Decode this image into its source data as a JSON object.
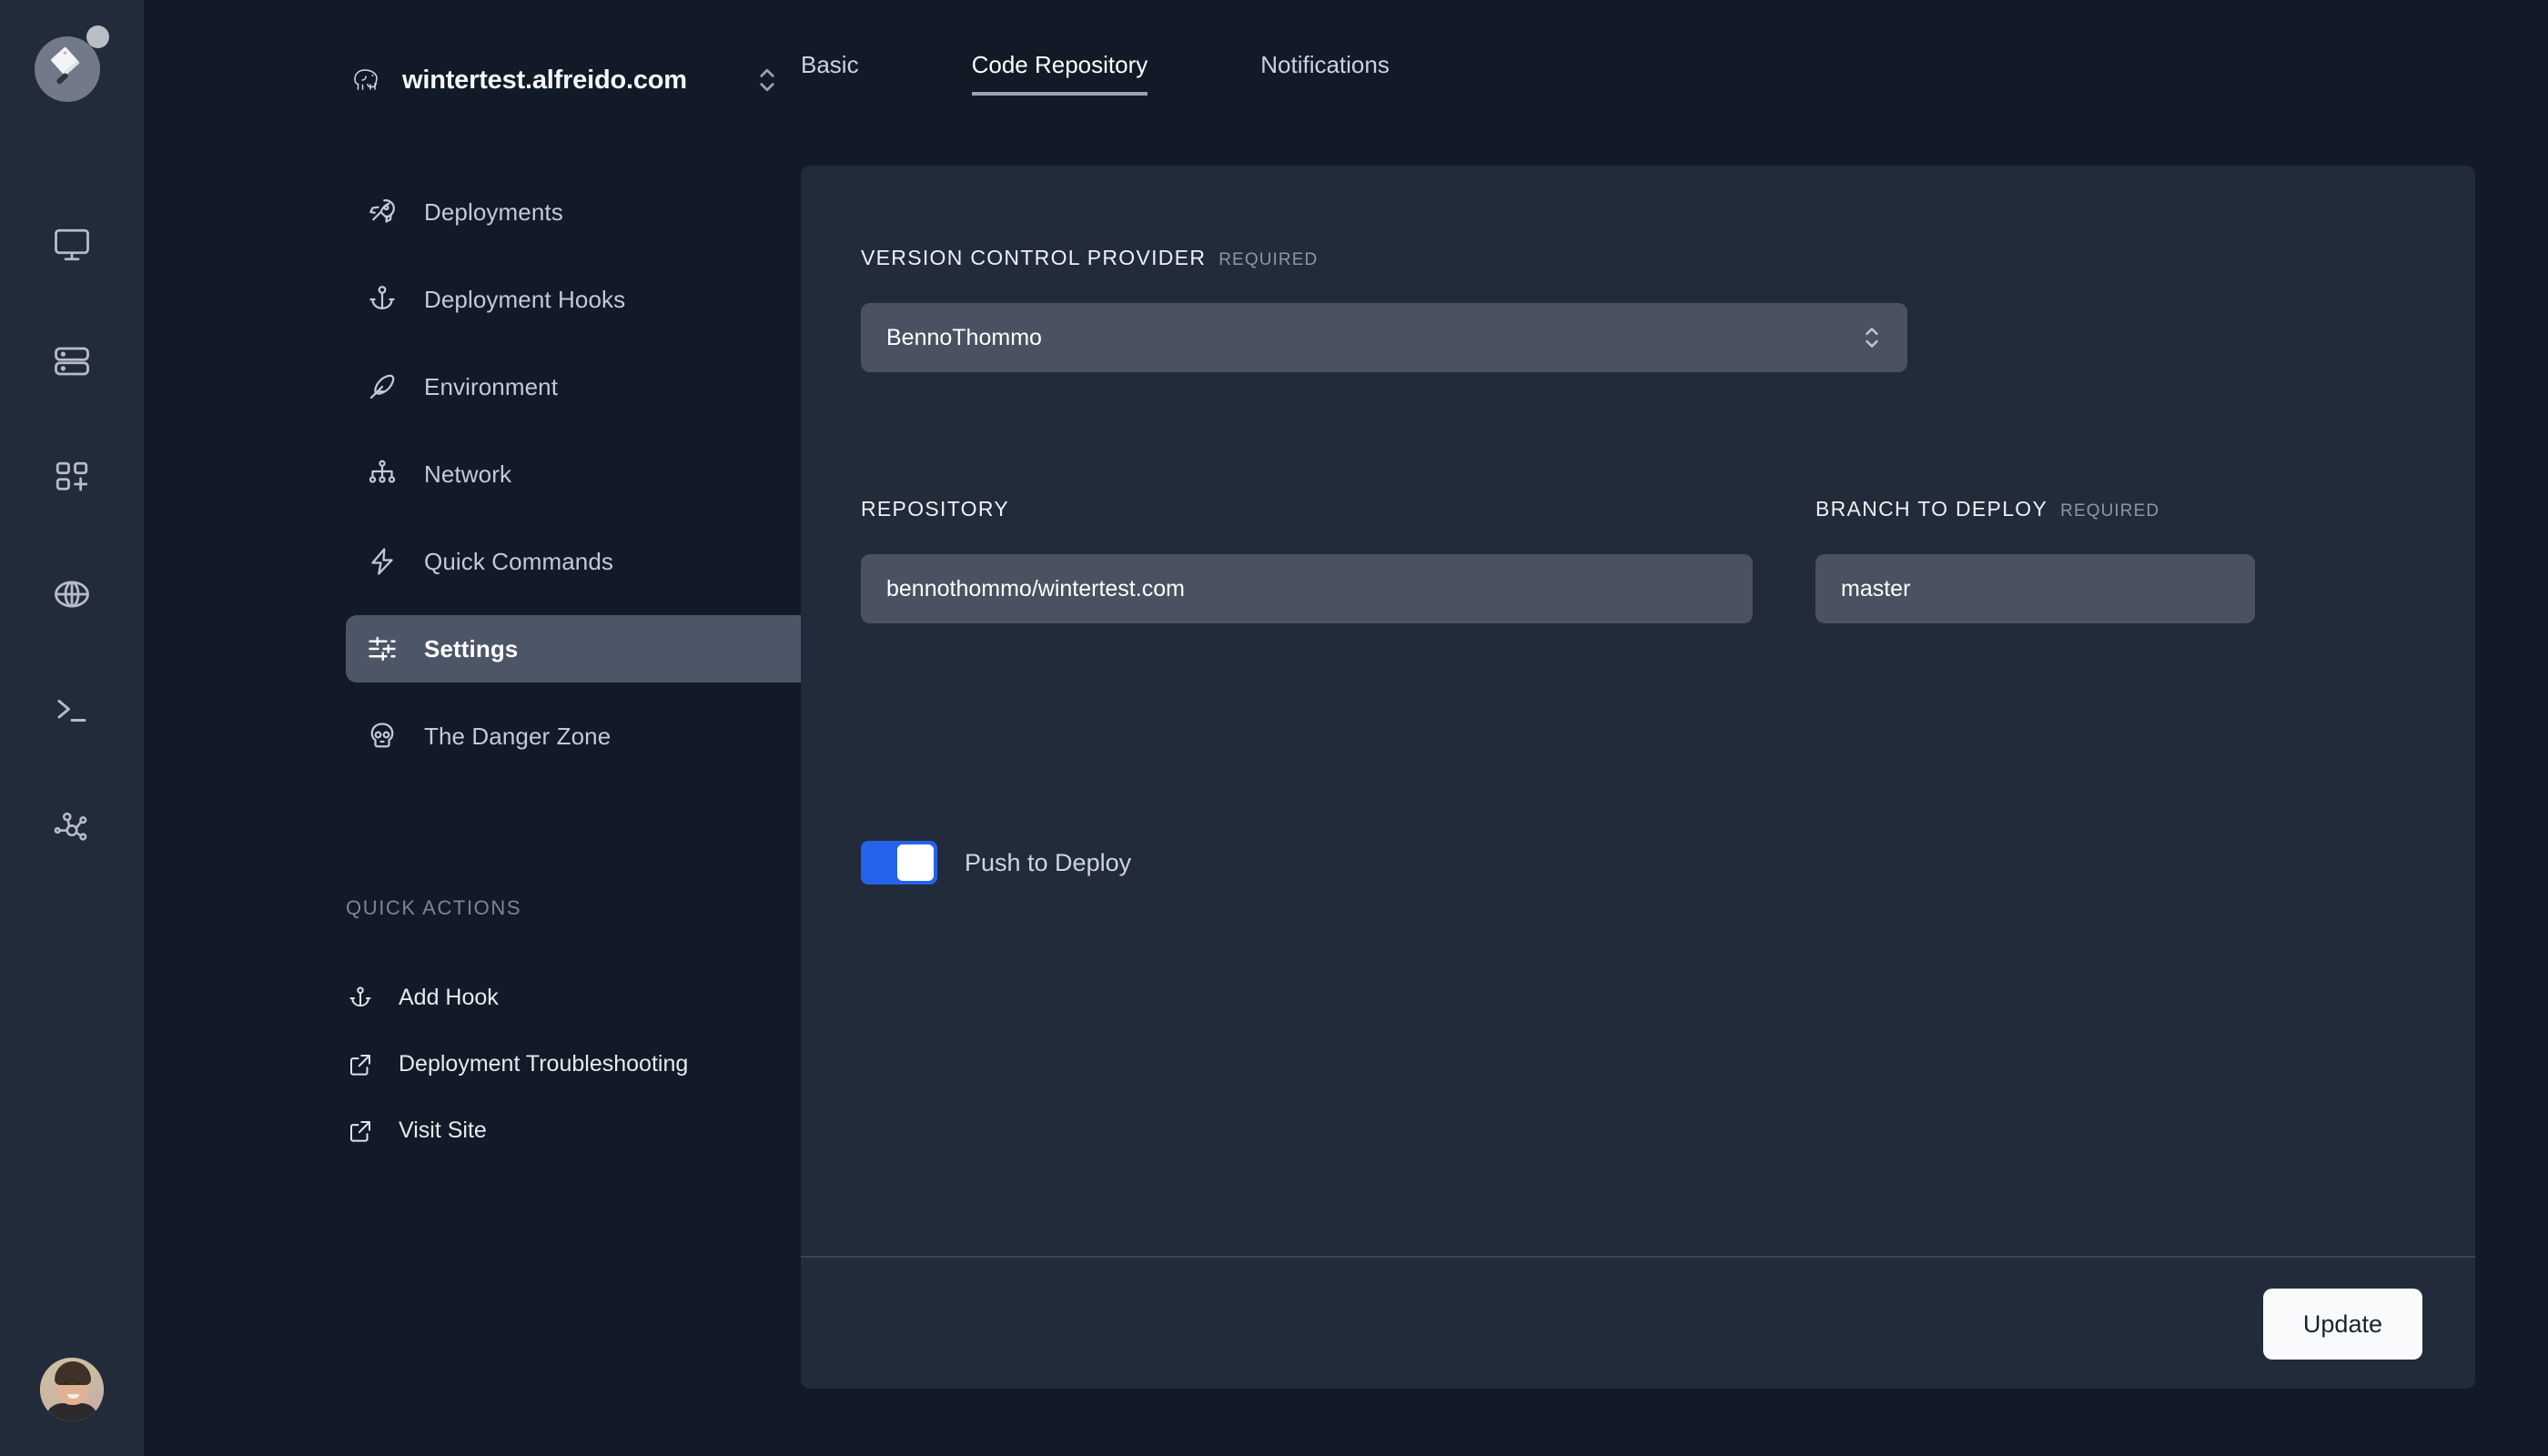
{
  "brand": {
    "logo_icon": "cleaver-icon",
    "logo_badge_icon": "badge-dot-icon"
  },
  "rail": {
    "items": [
      {
        "name": "monitor-icon",
        "label": "Servers"
      },
      {
        "name": "database-icon",
        "label": "Databases"
      },
      {
        "name": "grid-plus-icon",
        "label": "Apps"
      },
      {
        "name": "globe-icon",
        "label": "Domains"
      },
      {
        "name": "terminal-icon",
        "label": "Console"
      },
      {
        "name": "network-share-icon",
        "label": "Network"
      }
    ],
    "avatar": {
      "name": "user-avatar",
      "label": "Account"
    }
  },
  "sidebar": {
    "site": {
      "icon": "elephant-icon",
      "name": "wintertest.alfreido.com",
      "switcher_icon": "chevron-up-down-icon"
    },
    "nav": [
      {
        "label": "Deployments",
        "icon": "rocket-icon",
        "active": false
      },
      {
        "label": "Deployment Hooks",
        "icon": "anchor-icon",
        "active": false
      },
      {
        "label": "Environment",
        "icon": "feather-icon",
        "active": false
      },
      {
        "label": "Network",
        "icon": "network-tree-icon",
        "active": false
      },
      {
        "label": "Quick Commands",
        "icon": "lightning-icon",
        "active": false
      },
      {
        "label": "Settings",
        "icon": "sliders-icon",
        "active": true
      },
      {
        "label": "The Danger Zone",
        "icon": "skull-icon",
        "active": false
      }
    ],
    "quick_actions": {
      "title": "QUICK ACTIONS",
      "items": [
        {
          "label": "Add Hook",
          "icon": "anchor-icon"
        },
        {
          "label": "Deployment Troubleshooting",
          "icon": "external-link-icon"
        },
        {
          "label": "Visit Site",
          "icon": "external-link-icon"
        }
      ]
    }
  },
  "main": {
    "tabs": [
      {
        "label": "Basic",
        "active": false
      },
      {
        "label": "Code Repository",
        "active": true
      },
      {
        "label": "Notifications",
        "active": false
      }
    ],
    "form": {
      "provider": {
        "label": "VERSION CONTROL PROVIDER",
        "required_text": "REQUIRED",
        "value": "BennoThommo",
        "chevron_icon": "chevron-up-down-icon"
      },
      "repository": {
        "label": "REPOSITORY",
        "required_text": "",
        "value": "bennothommo/wintertest.com",
        "placeholder": "bennothommo/wintertest.com"
      },
      "branch": {
        "label": "BRANCH TO DEPLOY",
        "required_text": "REQUIRED",
        "value": "master",
        "placeholder": "master"
      },
      "push_to_deploy": {
        "label": "Push to Deploy",
        "enabled": true
      }
    },
    "footer": {
      "update_label": "Update"
    }
  },
  "colors": {
    "rail_bg": "#212b3a",
    "sidebar_bg": "#121a28",
    "panel_bg": "#222b3a",
    "input_bg": "#4a5261",
    "accent_toggle": "#2563eb",
    "active_nav_bg": "#4d5666",
    "button_bg": "#f9fafb"
  }
}
